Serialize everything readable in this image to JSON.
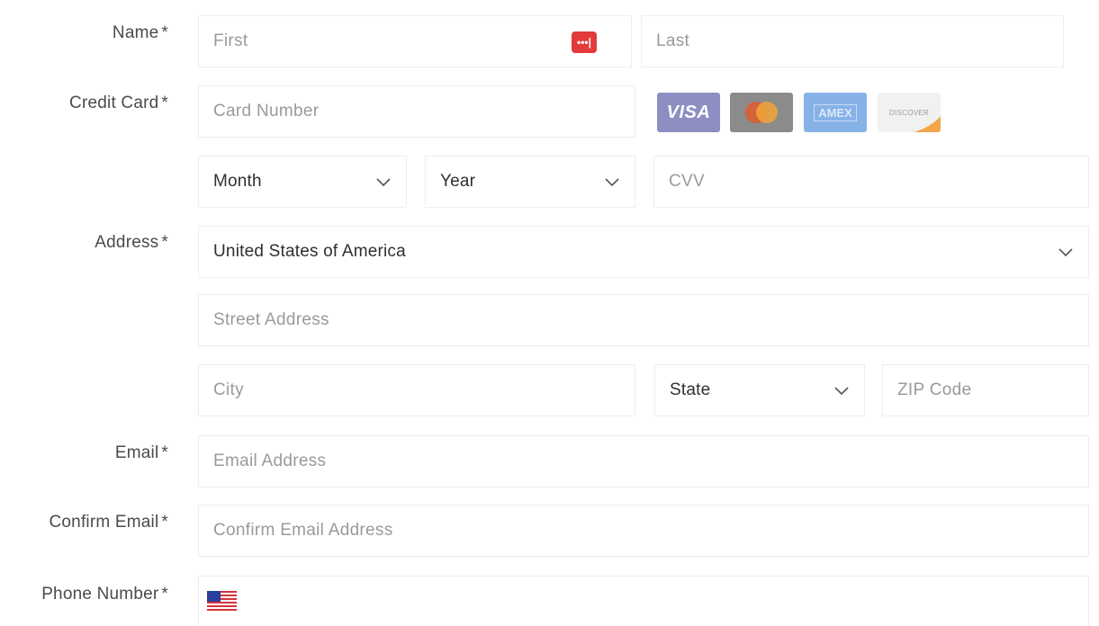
{
  "labels": {
    "name": "Name",
    "credit_card": "Credit Card",
    "address": "Address",
    "email": "Email",
    "confirm_email": "Confirm Email",
    "phone_number": "Phone Number",
    "required_marker": "*"
  },
  "name": {
    "first_placeholder": "First",
    "last_placeholder": "Last",
    "password_manager_icon": "password-manager-icon"
  },
  "credit_card": {
    "card_number_placeholder": "Card Number",
    "brands": [
      "VISA",
      "Mastercard",
      "AMEX",
      "DISCOVER"
    ],
    "month_value": "Month",
    "year_value": "Year",
    "cvv_placeholder": "CVV"
  },
  "address": {
    "country_value": "United States of America",
    "street_placeholder": "Street Address",
    "city_placeholder": "City",
    "state_value": "State",
    "zip_placeholder": "ZIP Code"
  },
  "email": {
    "placeholder": "Email Address",
    "confirm_placeholder": "Confirm Email Address"
  },
  "phone": {
    "flag_icon": "us-flag-icon"
  },
  "colors": {
    "required": "#4a4a4a",
    "placeholder": "#9a9a9a",
    "field_border": "#eeeeee",
    "password_manager": "#e23b3b",
    "visa": "#8d8ec1",
    "mastercard": "#8b8b8b",
    "amex": "#86b2e8",
    "discover": "#f1f1f1"
  }
}
